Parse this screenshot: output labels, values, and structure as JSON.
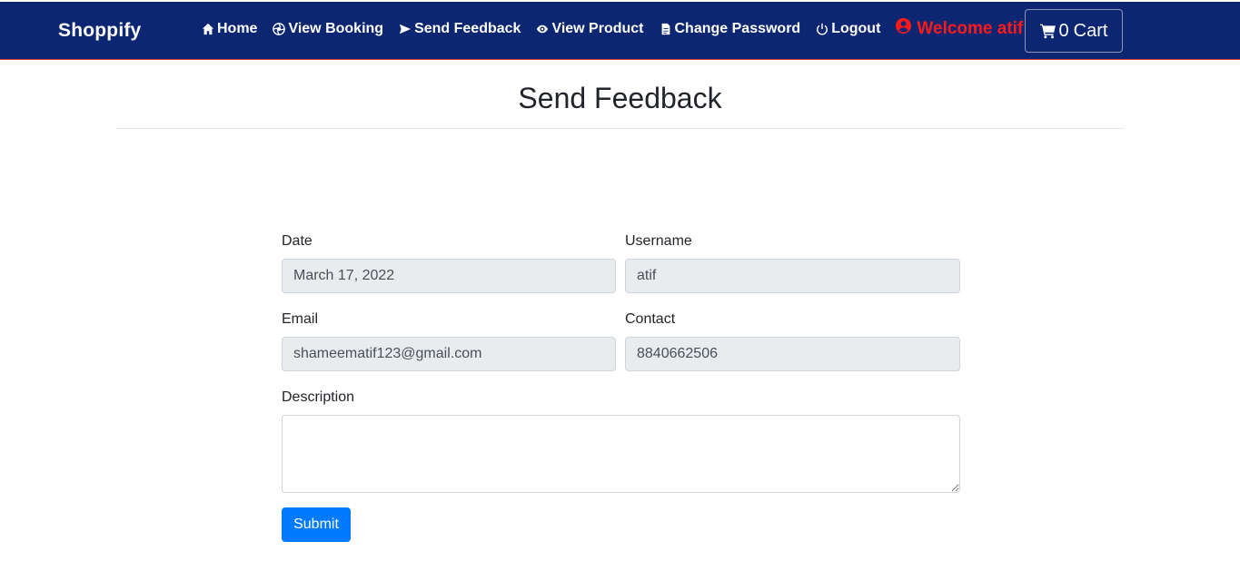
{
  "navbar": {
    "brand": "Shoppify",
    "links": [
      {
        "label": "Home",
        "icon": "home-icon"
      },
      {
        "label": "View Booking",
        "icon": "aperture-icon"
      },
      {
        "label": "Send Feedback",
        "icon": "send-icon"
      },
      {
        "label": "View Product",
        "icon": "eye-icon"
      },
      {
        "label": "Change Password",
        "icon": "document-icon"
      },
      {
        "label": "Logout",
        "icon": "power-icon"
      }
    ],
    "welcome": "Welcome atif",
    "cart": {
      "count": "0",
      "label": "Cart"
    }
  },
  "page": {
    "title": "Send Feedback"
  },
  "form": {
    "date_label": "Date",
    "date_value": "March 17, 2022",
    "username_label": "Username",
    "username_value": "atif",
    "email_label": "Email",
    "email_value": "shameematif123@gmail.com",
    "contact_label": "Contact",
    "contact_value": "8840662506",
    "description_label": "Description",
    "description_value": "",
    "submit_label": "Submit"
  },
  "colors": {
    "navbar_bg": "#0d2672",
    "welcome": "#ff1a1a",
    "primary_button": "#007bff",
    "readonly_field_bg": "#e9ecef"
  }
}
